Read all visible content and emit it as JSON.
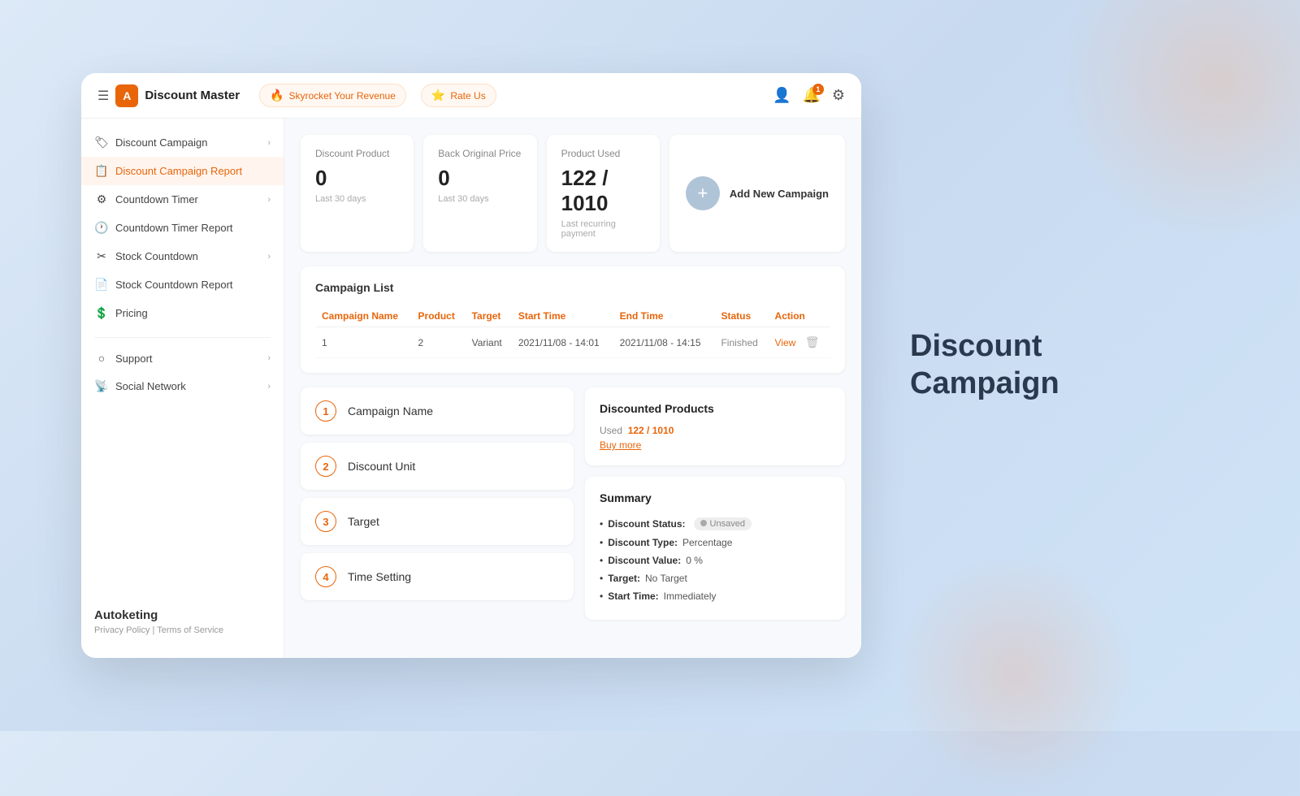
{
  "app": {
    "logo_letter": "A",
    "title": "Discount Master",
    "nav_promo": "Skyrocket Your Revenue",
    "nav_rate": "Rate Us",
    "notification_count": "1"
  },
  "sidebar": {
    "sections": [
      {
        "items": [
          {
            "id": "discount-campaign",
            "label": "Discount Campaign",
            "icon": "🏷",
            "has_arrow": true,
            "active": false
          },
          {
            "id": "discount-campaign-report",
            "label": "Discount Campaign Report",
            "icon": "📋",
            "has_arrow": false,
            "active": true
          },
          {
            "id": "countdown-timer",
            "label": "Countdown Timer",
            "icon": "⚙",
            "has_arrow": true,
            "active": false
          },
          {
            "id": "countdown-timer-report",
            "label": "Countdown Timer Report",
            "icon": "🕐",
            "has_arrow": false,
            "active": false
          },
          {
            "id": "stock-countdown",
            "label": "Stock Countdown",
            "icon": "✂",
            "has_arrow": true,
            "active": false
          },
          {
            "id": "stock-countdown-report",
            "label": "Stock Countdown Report",
            "icon": "📄",
            "has_arrow": false,
            "active": false
          },
          {
            "id": "pricing",
            "label": "Pricing",
            "icon": "💲",
            "has_arrow": false,
            "active": false
          }
        ]
      },
      {
        "items": [
          {
            "id": "support",
            "label": "Support",
            "icon": "○",
            "has_arrow": true,
            "active": false
          },
          {
            "id": "social-network",
            "label": "Social Network",
            "icon": "📡",
            "has_arrow": true,
            "active": false
          }
        ]
      }
    ],
    "brand": "Autoketing",
    "privacy_policy": "Privacy Policy",
    "terms": "Terms of Service"
  },
  "stats": [
    {
      "id": "discount-product",
      "title": "Discount Product",
      "value": "0",
      "sub": "Last 30 days"
    },
    {
      "id": "back-original-price",
      "title": "Back Original Price",
      "value": "0",
      "sub": "Last 30 days"
    },
    {
      "id": "product-used",
      "title": "Product Used",
      "value": "122 / 1010",
      "sub": "Last recurring payment"
    }
  ],
  "add_campaign": {
    "label": "Add New Campaign"
  },
  "campaign_list": {
    "title": "Campaign List",
    "columns": [
      "Campaign Name",
      "Product",
      "Target",
      "Start Time",
      "End Time",
      "Status",
      "Action"
    ],
    "rows": [
      {
        "name": "1",
        "product": "2",
        "target": "Variant",
        "start_time": "2021/11/08 - 14:01",
        "end_time": "2021/11/08 - 14:15",
        "status": "Finished",
        "action": "View"
      }
    ]
  },
  "form_steps": [
    {
      "num": "1",
      "label": "Campaign Name"
    },
    {
      "num": "2",
      "label": "Discount Unit"
    },
    {
      "num": "3",
      "label": "Target"
    },
    {
      "num": "4",
      "label": "Time Setting"
    }
  ],
  "summary_panel": {
    "discounted_products": {
      "title": "Discounted Products",
      "used_label": "Used",
      "used_value": "122 / 1010",
      "buy_more": "Buy more"
    },
    "summary": {
      "title": "Summary",
      "items": [
        {
          "label": "Discount Status:",
          "value": "Unsaved",
          "badge": true
        },
        {
          "label": "Discount Type:",
          "value": "Percentage"
        },
        {
          "label": "Discount Value:",
          "value": "0 %"
        },
        {
          "label": "Target:",
          "value": "No Target"
        },
        {
          "label": "Start Time:",
          "value": "Immediately"
        }
      ]
    }
  },
  "right_title": "Discount Campaign"
}
